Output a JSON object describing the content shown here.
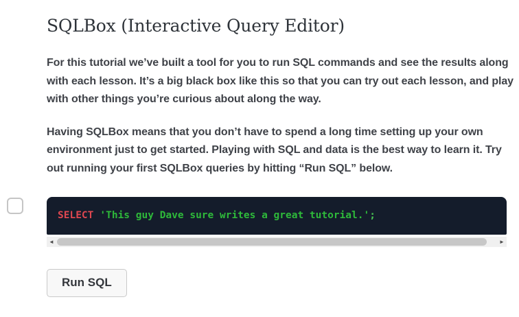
{
  "page": {
    "title": "SQLBox (Interactive Query Editor)",
    "paragraphs": [
      "For this tutorial we’ve built a tool for you to run SQL commands and see the results along with each lesson. It’s a big black box like this so that you can try out each lesson, and play with other things you’re curious about along the way.",
      "Having SQLBox means that you don’t have to spend a long time setting up your own environment just to get started. Playing with SQL and data is the best way to learn it. Try out running your first SQLBox queries by hitting “Run SQL” below."
    ]
  },
  "sqlbox": {
    "checkbox_checked": false,
    "code": {
      "keyword": "SELECT",
      "string": "'This guy Dave sure writes a great tutorial.'",
      "terminator": ";"
    },
    "scrollbar": {
      "left_arrow": "◄",
      "right_arrow": "►"
    },
    "colors": {
      "editor_bg": "#141c2b",
      "keyword": "#de4750",
      "string": "#2eb93a",
      "punct": "#49c253"
    },
    "run_button_label": "Run SQL"
  }
}
